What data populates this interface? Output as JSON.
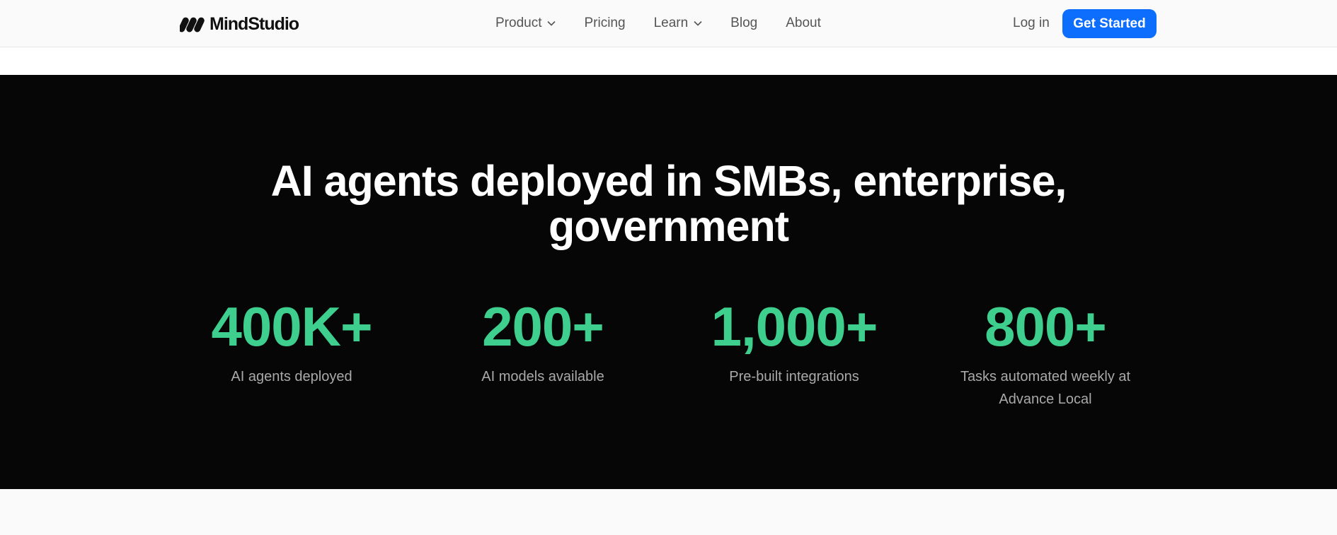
{
  "nav": {
    "logo_text": "MindStudio",
    "links": [
      {
        "label": "Product",
        "has_dropdown": true
      },
      {
        "label": "Pricing",
        "has_dropdown": false
      },
      {
        "label": "Learn",
        "has_dropdown": true
      },
      {
        "label": "Blog",
        "has_dropdown": false
      },
      {
        "label": "About",
        "has_dropdown": false
      }
    ],
    "login_label": "Log in",
    "cta_label": "Get Started"
  },
  "stats_section": {
    "headline_line1": "AI agents deployed in SMBs, enterprise,",
    "headline_line2": "government",
    "items": [
      {
        "value": "400K+",
        "label": "AI agents deployed"
      },
      {
        "value": "200+",
        "label": "AI models available"
      },
      {
        "value": "1,000+",
        "label": "Pre-built integrations"
      },
      {
        "value": "800+",
        "label": "Tasks automated weekly at Advance Local"
      }
    ]
  },
  "colors": {
    "accent_green": "#3ecf8e",
    "cta_blue": "#0d6efd",
    "section_bg": "#060606"
  }
}
